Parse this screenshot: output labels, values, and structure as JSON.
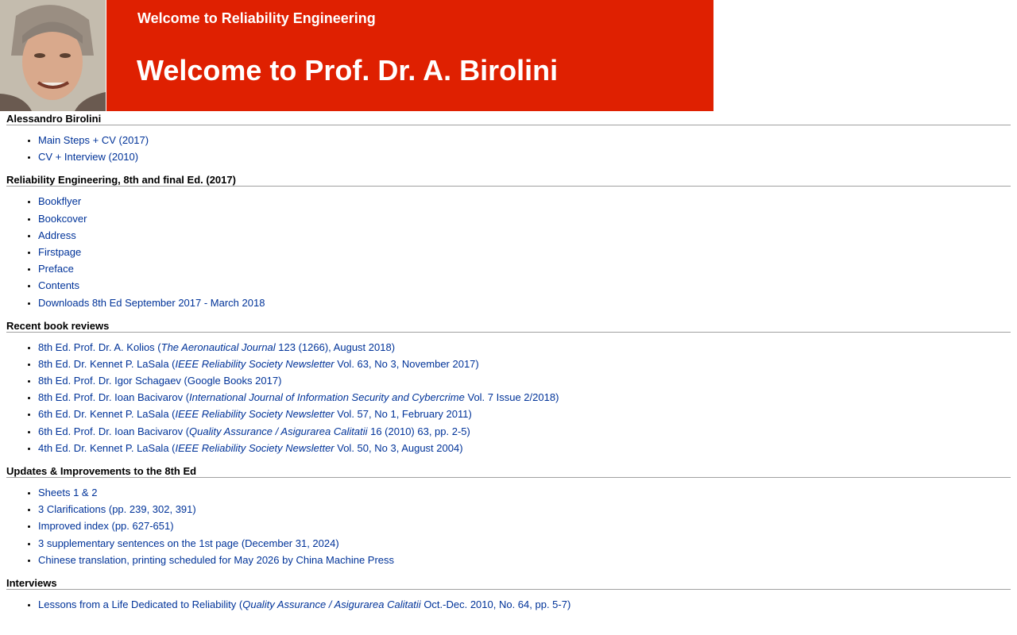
{
  "header": {
    "subtitle": "Welcome to Reliability Engineering",
    "title": "Welcome to Prof. Dr. A. Birolini",
    "accent_color": "#df2001"
  },
  "sections": [
    {
      "title": "Alessandro Birolini",
      "items": [
        {
          "text": "Main Steps + CV (2017)"
        },
        {
          "text": "CV + Interview (2010)"
        }
      ]
    },
    {
      "title": "Reliability Engineering, 8th and final Ed. (2017)",
      "items": [
        {
          "text": "Bookflyer"
        },
        {
          "text": "Bookcover"
        },
        {
          "text": "Address"
        },
        {
          "text": "Firstpage"
        },
        {
          "text": "Preface"
        },
        {
          "text": "Contents"
        },
        {
          "text": "Downloads 8th Ed September 2017 - March 2018"
        }
      ]
    },
    {
      "title": "Recent book reviews",
      "items": [
        {
          "pre": "8th Ed. Prof. Dr. A. Kolios (",
          "em": "The Aeronautical Journal",
          "post": " 123 (1266), August 2018)"
        },
        {
          "pre": "8th Ed. Dr. Kennet P. LaSala (",
          "em": "IEEE Reliability Society Newsletter",
          "post": " Vol. 63, No 3, November 2017)"
        },
        {
          "pre": "8th Ed. Prof. Dr. Igor Schagaev (Google Books 2017)",
          "em": "",
          "post": ""
        },
        {
          "pre": "8th Ed. Prof. Dr. Ioan Bacivarov (",
          "em": "International Journal of Information Security and Cybercrime",
          "post": " Vol. 7 Issue 2/2018)"
        },
        {
          "pre": "6th Ed. Dr. Kennet P. LaSala (",
          "em": "IEEE Reliability Society Newsletter",
          "post": " Vol. 57, No 1, February 2011)"
        },
        {
          "pre": "6th Ed. Prof. Dr. Ioan Bacivarov (",
          "em": "Quality Assurance / Asigurarea Calitatii",
          "post": " 16 (2010) 63, pp. 2-5)"
        },
        {
          "pre": "4th Ed. Dr. Kennet P. LaSala (",
          "em": "IEEE Reliability Society Newsletter",
          "post": " Vol. 50, No 3, August 2004)"
        }
      ]
    },
    {
      "title": "Updates & Improvements to the 8th Ed",
      "items": [
        {
          "text": "Sheets 1 & 2"
        },
        {
          "text": "3 Clarifications (pp. 239, 302, 391)"
        },
        {
          "text": "Improved index (pp. 627-651)"
        },
        {
          "text": "3 supplementary sentences on the 1st page (December 31, 2024)"
        },
        {
          "text": "Chinese translation, printing scheduled for May 2026 by China Machine Press"
        }
      ]
    },
    {
      "title": "Interviews",
      "items": [
        {
          "pre": "Lessons from a Life Dedicated to Reliability (",
          "em": "Quality Assurance / Asigurarea Calitatii",
          "post": " Oct.-Dec. 2010, No. 64, pp. 5-7)"
        }
      ]
    }
  ]
}
